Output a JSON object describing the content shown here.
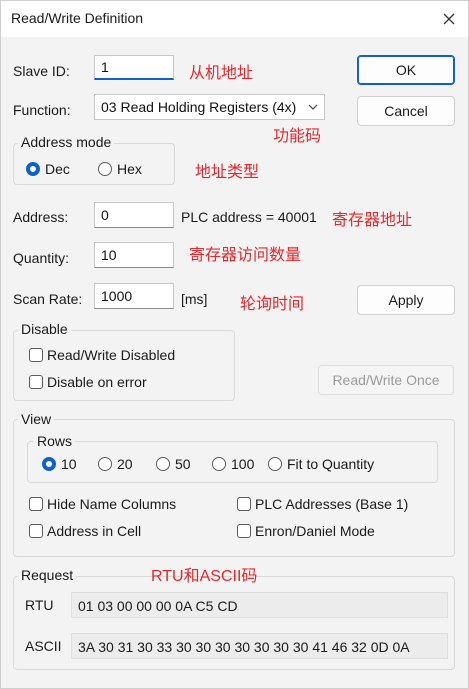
{
  "window": {
    "title": "Read/Write Definition",
    "close_icon": "close-icon"
  },
  "form": {
    "slave_id_label": "Slave ID:",
    "slave_id_value": "1",
    "function_label": "Function:",
    "function_value": "03 Read Holding Registers (4x)",
    "address_mode_label": "Address mode",
    "mode_dec": "Dec",
    "mode_hex": "Hex",
    "mode_selected": "Dec",
    "address_label": "Address:",
    "address_value": "0",
    "plc_address_text": "PLC address = 40001",
    "quantity_label": "Quantity:",
    "quantity_value": "10",
    "scan_rate_label": "Scan Rate:",
    "scan_rate_value": "1000",
    "scan_rate_unit": "[ms]"
  },
  "buttons": {
    "ok": "OK",
    "cancel": "Cancel",
    "apply": "Apply",
    "read_write_once": "Read/Write Once"
  },
  "annotations": {
    "slave_id": "从机地址",
    "function": "功能码",
    "address_mode": "地址类型",
    "address": "寄存器地址",
    "quantity": "寄存器访问数量",
    "scan_rate": "轮询时间",
    "request": "RTU和ASCII码",
    "color": "#e8272c"
  },
  "disable": {
    "label": "Disable",
    "read_write_disabled": "Read/Write Disabled",
    "disable_on_error": "Disable on error"
  },
  "view": {
    "label": "View",
    "rows_label": "Rows",
    "rows_options": [
      "10",
      "20",
      "50",
      "100",
      "Fit to Quantity"
    ],
    "rows_selected": "10",
    "hide_name_columns": "Hide Name Columns",
    "plc_addresses": "PLC Addresses (Base 1)",
    "address_in_cell": "Address in Cell",
    "enron_daniel": "Enron/Daniel Mode"
  },
  "request": {
    "label": "Request",
    "rtu_label": "RTU",
    "rtu_value": "01 03 00 00 00 0A C5 CD",
    "ascii_label": "ASCII",
    "ascii_value": "3A 30 31 30 33 30 30 30 30 30 30 30 41 46 32 0D 0A"
  },
  "colors": {
    "accent": "#0f62c5",
    "background": "#f3f3f3"
  }
}
